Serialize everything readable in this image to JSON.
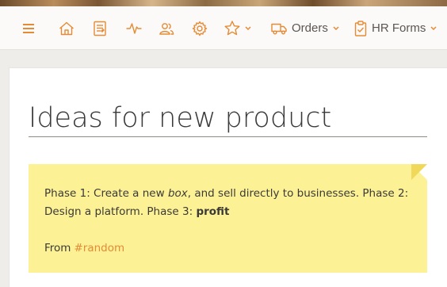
{
  "colors": {
    "accent": "#e58b35",
    "note_background": "#fcf195",
    "note_fold": "#f0d85a",
    "toolbar_background": "#fbfaf9",
    "page_background": "#efedea"
  },
  "toolbar": {
    "menu_icon": "hamburger-menu-icon",
    "home_icon": "home-icon",
    "notes_icon": "notes-document-icon",
    "activity_icon": "activity-pulse-icon",
    "people_icon": "people-icon",
    "settings_icon": "gear-icon",
    "favorites_icon": "star-icon",
    "orders_label": "Orders",
    "orders_icon": "truck-icon",
    "hr_forms_label": "HR Forms",
    "hr_forms_icon": "clipboard-icon",
    "dropdown_icon": "chevron-down-icon"
  },
  "page": {
    "title": "Ideas for new product"
  },
  "note": {
    "text_part1": "Phase 1: Create a new ",
    "text_italic": "box",
    "text_part2": ", and sell directly to businesses. Phase 2: Design a platform. Phase 3: ",
    "text_bold": "profit",
    "from_label": "From",
    "tag": "#random"
  }
}
